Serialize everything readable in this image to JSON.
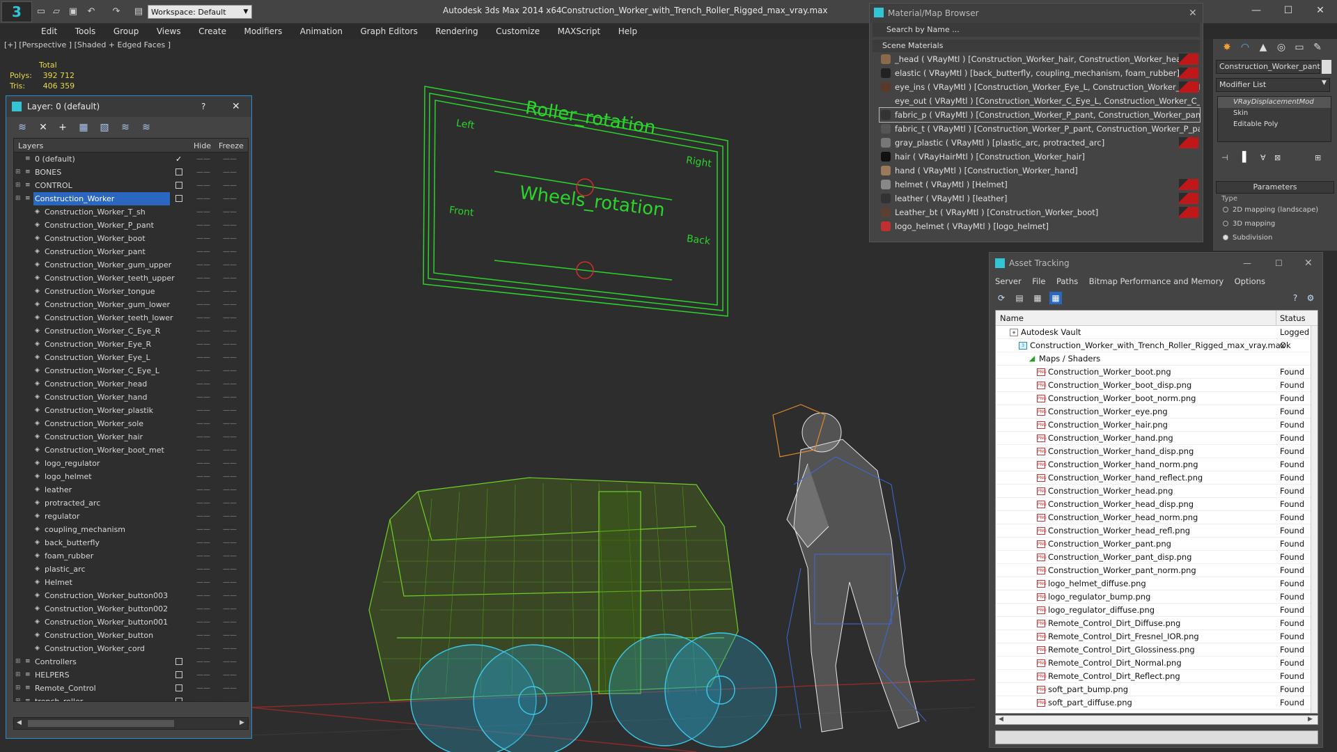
{
  "titlebar": {
    "logo": "3",
    "workspace": "Workspace: Default",
    "app_title": "Autodesk 3ds Max  2014 x64",
    "document": "Construction_Worker_with_Trench_Roller_Rigged_max_vray.max",
    "minimize": "—",
    "maximize": "☐",
    "close": "✕"
  },
  "menu": [
    "Edit",
    "Tools",
    "Group",
    "Views",
    "Create",
    "Modifiers",
    "Animation",
    "Graph Editors",
    "Rendering",
    "Customize",
    "MAXScript",
    "Help"
  ],
  "viewport": {
    "label": "[+] [Perspective ] [Shaded + Edged Faces ]",
    "stats": {
      "total_label": "Total",
      "polys_label": "Polys:",
      "polys_value": "392 712",
      "tris_label": "Tris:",
      "tris_value": "406 359"
    },
    "control_panel": {
      "roller_title": "Roller_rotation",
      "left": "Left",
      "right": "Right",
      "wheels_title": "Wheels_rotation",
      "front": "Front",
      "back": "Back"
    }
  },
  "layer_dialog": {
    "title": "Layer: 0 (default)",
    "help": "?",
    "close": "✕",
    "col_layers": "Layers",
    "col_hide": "Hide",
    "col_freeze": "Freeze",
    "rows": [
      {
        "name": "0 (default)",
        "level": 0,
        "check": true
      },
      {
        "name": "BONES",
        "level": 0,
        "box": true
      },
      {
        "name": "CONTROL",
        "level": 0,
        "box": true
      },
      {
        "name": "Construction_Worker",
        "level": 0,
        "box": true,
        "selected": true
      },
      {
        "name": "Construction_Worker_T_sh",
        "level": 1
      },
      {
        "name": "Construction_Worker_P_pant",
        "level": 1
      },
      {
        "name": "Construction_Worker_boot",
        "level": 1
      },
      {
        "name": "Construction_Worker_pant",
        "level": 1
      },
      {
        "name": "Construction_Worker_gum_upper",
        "level": 1
      },
      {
        "name": "Construction_Worker_teeth_upper",
        "level": 1
      },
      {
        "name": "Construction_Worker_tongue",
        "level": 1
      },
      {
        "name": "Construction_Worker_gum_lower",
        "level": 1
      },
      {
        "name": "Construction_Worker_teeth_lower",
        "level": 1
      },
      {
        "name": "Construction_Worker_C_Eye_R",
        "level": 1
      },
      {
        "name": "Construction_Worker_Eye_R",
        "level": 1
      },
      {
        "name": "Construction_Worker_Eye_L",
        "level": 1
      },
      {
        "name": "Construction_Worker_C_Eye_L",
        "level": 1
      },
      {
        "name": "Construction_Worker_head",
        "level": 1
      },
      {
        "name": "Construction_Worker_hand",
        "level": 1
      },
      {
        "name": "Construction_Worker_plastik",
        "level": 1
      },
      {
        "name": "Construction_Worker_sole",
        "level": 1
      },
      {
        "name": "Construction_Worker_hair",
        "level": 1
      },
      {
        "name": "Construction_Worker_boot_met",
        "level": 1
      },
      {
        "name": "logo_regulator",
        "level": 1
      },
      {
        "name": "logo_helmet",
        "level": 1
      },
      {
        "name": "leather",
        "level": 1
      },
      {
        "name": "protracted_arc",
        "level": 1
      },
      {
        "name": "regulator",
        "level": 1
      },
      {
        "name": "coupling_mechanism",
        "level": 1
      },
      {
        "name": "back_butterfly",
        "level": 1
      },
      {
        "name": "foam_rubber",
        "level": 1
      },
      {
        "name": "plastic_arc",
        "level": 1
      },
      {
        "name": "Helmet",
        "level": 1
      },
      {
        "name": "Construction_Worker_button003",
        "level": 1
      },
      {
        "name": "Construction_Worker_button002",
        "level": 1
      },
      {
        "name": "Construction_Worker_button001",
        "level": 1
      },
      {
        "name": "Construction_Worker_button",
        "level": 1
      },
      {
        "name": "Construction_Worker_cord",
        "level": 1
      },
      {
        "name": "Controllers",
        "level": 0,
        "box": true
      },
      {
        "name": "HELPERS",
        "level": 0,
        "box": true
      },
      {
        "name": "Remote_Control",
        "level": 0,
        "box": true
      },
      {
        "name": "trench_roller",
        "level": 0,
        "box": true
      }
    ]
  },
  "material_browser": {
    "title": "Material/Map Browser",
    "close": "✕",
    "search_placeholder": "Search by Name ...",
    "section": "Scene Materials",
    "rows": [
      {
        "text": "_head  ( VRayMtl ) [Construction_Worker_hair, Construction_Worker_head]",
        "flag": true,
        "swatch": "#8a6a4a"
      },
      {
        "text": "elastic  ( VRayMtl ) [back_butterfly, coupling_mechanism, foam_rubber]",
        "flag": true,
        "swatch": "#222"
      },
      {
        "text": "eye_ins  ( VRayMtl ) [Construction_Worker_Eye_L, Construction_Worker_Eye_R]",
        "flag": true,
        "swatch": "#5a3a2a"
      },
      {
        "text": "eye_out  ( VRayMtl ) [Construction_Worker_C_Eye_L, Construction_Worker_C_Ey...",
        "flag": false,
        "swatch": "#444"
      },
      {
        "text": "fabric_p  ( VRayMtl ) [Construction_Worker_P_pant, Construction_Worker_pant,...",
        "flag": false,
        "swatch": "#333",
        "selected": true
      },
      {
        "text": "fabric_t  ( VRayMtl ) [Construction_Worker_P_pant, Construction_Worker_P_pant...",
        "flag": false,
        "swatch": "#555"
      },
      {
        "text": "gray_plastic  ( VRayMtl ) [plastic_arc, protracted_arc]",
        "flag": true,
        "swatch": "#777"
      },
      {
        "text": "hair  ( VRayHairMtl ) [Construction_Worker_hair]",
        "flag": false,
        "swatch": "#111"
      },
      {
        "text": "hand  ( VRayMtl ) [Construction_Worker_hand]",
        "flag": false,
        "swatch": "#9a7a5a"
      },
      {
        "text": "helmet  ( VRayMtl ) [Helmet]",
        "flag": true,
        "swatch": "#888"
      },
      {
        "text": "leather  ( VRayMtl ) [leather]",
        "flag": true,
        "swatch": "#333"
      },
      {
        "text": "Leather_bt  ( VRayMtl ) [Construction_Worker_boot]",
        "flag": true,
        "swatch": "#5a4030"
      },
      {
        "text": "logo_helmet  ( VRayMtl ) [logo_helmet]",
        "flag": false,
        "swatch": "#c03030"
      }
    ]
  },
  "command_panel": {
    "object_name": "Construction_Worker_pant",
    "modifier_list": "Modifier List",
    "stack": [
      "VRayDisplacementMod",
      "Skin",
      "Editable Poly"
    ],
    "parameters": "Parameters",
    "type_label": "Type",
    "options": [
      {
        "label": "2D mapping (landscape)",
        "on": false
      },
      {
        "label": "3D mapping",
        "on": false
      },
      {
        "label": "Subdivision",
        "on": true
      }
    ]
  },
  "asset_tracking": {
    "title": "Asset Tracking",
    "minimize": "—",
    "maximize": "☐",
    "close": "✕",
    "menu": [
      "Server",
      "File",
      "Paths",
      "Bitmap Performance and Memory",
      "Options"
    ],
    "col_name": "Name",
    "col_status": "Status",
    "rows": [
      {
        "name": "Autodesk Vault",
        "status": "Logged",
        "indent": 0,
        "kind": "vault"
      },
      {
        "name": "Construction_Worker_with_Trench_Roller_Rigged_max_vray.max",
        "status": "Ok",
        "indent": 1,
        "kind": "max"
      },
      {
        "name": "Maps / Shaders",
        "status": "",
        "indent": 2,
        "kind": "folder"
      },
      {
        "name": "Construction_Worker_boot.png",
        "status": "Found",
        "indent": 3,
        "kind": "png"
      },
      {
        "name": "Construction_Worker_boot_disp.png",
        "status": "Found",
        "indent": 3,
        "kind": "png"
      },
      {
        "name": "Construction_Worker_boot_norm.png",
        "status": "Found",
        "indent": 3,
        "kind": "png"
      },
      {
        "name": "Construction_Worker_eye.png",
        "status": "Found",
        "indent": 3,
        "kind": "png"
      },
      {
        "name": "Construction_Worker_hair.png",
        "status": "Found",
        "indent": 3,
        "kind": "png"
      },
      {
        "name": "Construction_Worker_hand.png",
        "status": "Found",
        "indent": 3,
        "kind": "png"
      },
      {
        "name": "Construction_Worker_hand_disp.png",
        "status": "Found",
        "indent": 3,
        "kind": "png"
      },
      {
        "name": "Construction_Worker_hand_norm.png",
        "status": "Found",
        "indent": 3,
        "kind": "png"
      },
      {
        "name": "Construction_Worker_hand_reflect.png",
        "status": "Found",
        "indent": 3,
        "kind": "png"
      },
      {
        "name": "Construction_Worker_head.png",
        "status": "Found",
        "indent": 3,
        "kind": "png"
      },
      {
        "name": "Construction_Worker_head_disp.png",
        "status": "Found",
        "indent": 3,
        "kind": "png"
      },
      {
        "name": "Construction_Worker_head_norm.png",
        "status": "Found",
        "indent": 3,
        "kind": "png"
      },
      {
        "name": "Construction_Worker_head_refl.png",
        "status": "Found",
        "indent": 3,
        "kind": "png"
      },
      {
        "name": "Construction_Worker_pant.png",
        "status": "Found",
        "indent": 3,
        "kind": "png"
      },
      {
        "name": "Construction_Worker_pant_disp.png",
        "status": "Found",
        "indent": 3,
        "kind": "png"
      },
      {
        "name": "Construction_Worker_pant_norm.png",
        "status": "Found",
        "indent": 3,
        "kind": "png"
      },
      {
        "name": "logo_helmet_diffuse.png",
        "status": "Found",
        "indent": 3,
        "kind": "png"
      },
      {
        "name": "logo_regulator_bump.png",
        "status": "Found",
        "indent": 3,
        "kind": "png"
      },
      {
        "name": "logo_regulator_diffuse.png",
        "status": "Found",
        "indent": 3,
        "kind": "png"
      },
      {
        "name": "Remote_Control_Dirt_Diffuse.png",
        "status": "Found",
        "indent": 3,
        "kind": "png"
      },
      {
        "name": "Remote_Control_Dirt_Fresnel_IOR.png",
        "status": "Found",
        "indent": 3,
        "kind": "png"
      },
      {
        "name": "Remote_Control_Dirt_Glossiness.png",
        "status": "Found",
        "indent": 3,
        "kind": "png"
      },
      {
        "name": "Remote_Control_Dirt_Normal.png",
        "status": "Found",
        "indent": 3,
        "kind": "png"
      },
      {
        "name": "Remote_Control_Dirt_Reflect.png",
        "status": "Found",
        "indent": 3,
        "kind": "png"
      },
      {
        "name": "soft_part_bump.png",
        "status": "Found",
        "indent": 3,
        "kind": "png"
      },
      {
        "name": "soft_part_diffuse.png",
        "status": "Found",
        "indent": 3,
        "kind": "png"
      }
    ]
  },
  "colors": {
    "wire_green": "#6fcf2a",
    "wire_cyan": "#3ec8e8",
    "panel_green": "#2bd42b",
    "selection_blue": "#2b67c0"
  }
}
